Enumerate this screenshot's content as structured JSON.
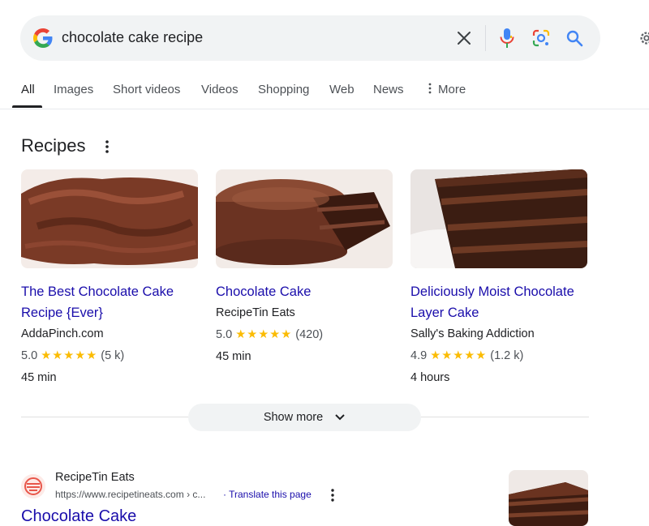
{
  "search": {
    "query": "chocolate cake recipe",
    "icons": [
      "google-logo-icon",
      "clear-icon",
      "mic-icon",
      "lens-icon",
      "search-icon",
      "settings-icon"
    ]
  },
  "tabs": [
    {
      "label": "All",
      "active": true
    },
    {
      "label": "Images"
    },
    {
      "label": "Short videos"
    },
    {
      "label": "Videos"
    },
    {
      "label": "Shopping"
    },
    {
      "label": "Web"
    },
    {
      "label": "News"
    },
    {
      "label": "More"
    }
  ],
  "recipes": {
    "title": "Recipes",
    "cards": [
      {
        "title": "The Best Chocolate Cake Recipe {Ever}",
        "source": "AddaPinch.com",
        "rating": "5.0",
        "stars": "★★★★★",
        "reviews": "(5 k)",
        "time": "45 min"
      },
      {
        "title": "Chocolate Cake",
        "source": "RecipeTin Eats",
        "rating": "5.0",
        "stars": "★★★★★",
        "reviews": "(420)",
        "time": "45 min"
      },
      {
        "title": "Deliciously Moist Chocolate Layer Cake",
        "source": "Sally's Baking Addiction",
        "rating": "4.9",
        "stars": "★★★★★",
        "reviews": "(1.2 k)",
        "time": "4 hours"
      }
    ],
    "show_more": "Show more"
  },
  "result": {
    "site_name": "RecipeTin Eats",
    "url": "https://www.recipetineats.com › c...",
    "translate": "Translate this page",
    "title": "Chocolate Cake"
  },
  "colors": {
    "link": "#1a0dab",
    "star": "#fbbc04",
    "searchbar_bg": "#f1f3f4",
    "google_blue": "#4285f4",
    "google_red": "#ea4335",
    "google_yellow": "#fbbc05",
    "google_green": "#34a853"
  }
}
